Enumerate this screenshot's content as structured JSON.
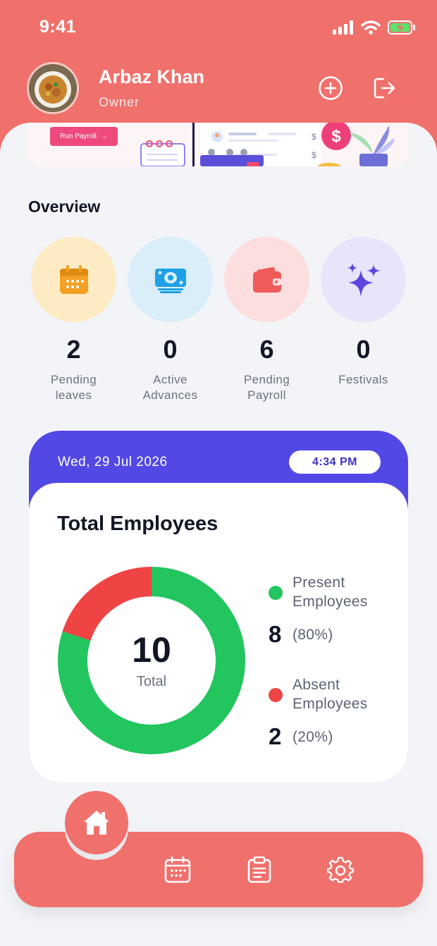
{
  "status_bar": {
    "time": "9:41"
  },
  "profile": {
    "name": "Arbaz Khan",
    "role": "Owner"
  },
  "banner": {
    "cta_label": "Run Payroll",
    "cta_arrow": "→"
  },
  "overview": {
    "title": "Overview",
    "stats": [
      {
        "value": "2",
        "label": "Pending leaves",
        "icon": "calendar-icon",
        "bg": "#fdebc4",
        "color": "#f4a024"
      },
      {
        "value": "0",
        "label": "Active Advances",
        "icon": "money-icon",
        "bg": "#d9eef9",
        "color": "#1ea1e6"
      },
      {
        "value": "6",
        "label": "Pending Payroll",
        "icon": "wallet-icon",
        "bg": "#fcdede",
        "color": "#ef5b5b"
      },
      {
        "value": "0",
        "label": "Festivals",
        "icon": "sparkles-icon",
        "bg": "#e8e4fa",
        "color": "#5a47e0"
      }
    ]
  },
  "employees": {
    "date": "Wed, 29 Jul 2026",
    "time": "4:34 PM",
    "title": "Total Employees",
    "total": "10",
    "total_label": "Total",
    "present": {
      "label": "Present Employees",
      "count": "8",
      "percent": "(80%)",
      "color": "#22c55e"
    },
    "absent": {
      "label": "Absent Employees",
      "count": "2",
      "percent": "(20%)",
      "color": "#ef4444"
    }
  },
  "chart_data": {
    "type": "pie",
    "categories": [
      "Present Employees",
      "Absent Employees"
    ],
    "values": [
      8,
      2
    ],
    "colors": [
      "#22c55e",
      "#ef4444"
    ]
  },
  "nav": {
    "items": [
      "home-icon",
      "calendar-icon",
      "clipboard-icon",
      "gear-icon"
    ],
    "active": "home-icon"
  },
  "colors": {
    "brand": "#f0706c",
    "accent": "#5248e4"
  }
}
